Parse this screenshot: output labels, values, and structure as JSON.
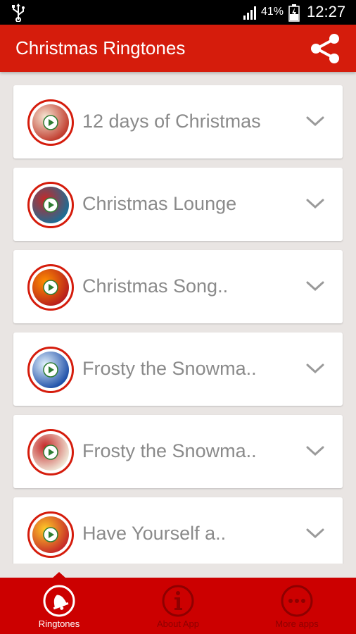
{
  "status_bar": {
    "battery_percent": "41%",
    "time": "12:27",
    "icons": [
      "usb-icon",
      "signal-icon",
      "battery-charging-icon"
    ]
  },
  "app_bar": {
    "title": "Christmas Ringtones",
    "share_icon": "share-icon"
  },
  "ringtones": [
    {
      "title": "12 days of Christmas",
      "colors": [
        "#c0392b",
        "#f5e6d3"
      ]
    },
    {
      "title": "Christmas Lounge",
      "colors": [
        "#1b6e96",
        "#c62828"
      ]
    },
    {
      "title": "Christmas Song..",
      "colors": [
        "#b71c1c",
        "#ff8f00"
      ]
    },
    {
      "title": "Frosty the Snowma..",
      "colors": [
        "#1e4fa8",
        "#e3f2fd"
      ]
    },
    {
      "title": "Frosty the Snowma..",
      "colors": [
        "#f0e8d8",
        "#c62828"
      ]
    },
    {
      "title": "Have Yourself a..",
      "colors": [
        "#c62828",
        "#ffca28"
      ]
    }
  ],
  "bottom_nav": {
    "items": [
      {
        "label": "Ringtones",
        "icon": "bell-icon",
        "active": true
      },
      {
        "label": "About App",
        "icon": "info-icon",
        "active": false
      },
      {
        "label": "More apps",
        "icon": "more-icon",
        "active": false
      }
    ]
  },
  "colors": {
    "primary_red": "#d51c0c",
    "nav_red": "#cc0000",
    "background": "#e9e5e3",
    "play_green": "#2e7d32"
  }
}
